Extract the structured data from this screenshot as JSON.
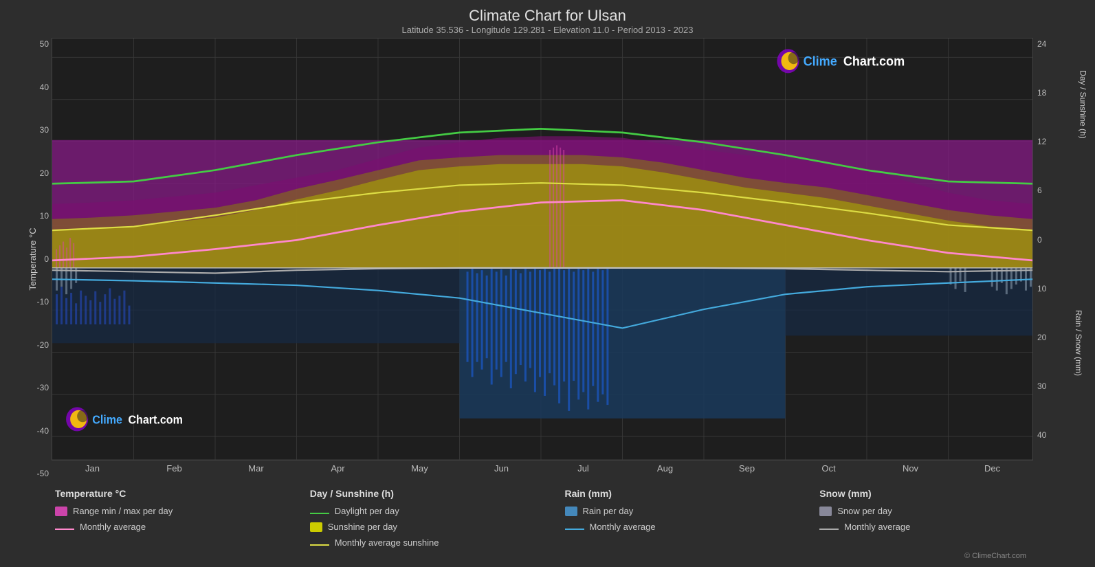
{
  "page": {
    "title": "Climate Chart for Ulsan",
    "subtitle": "Latitude 35.536 - Longitude 129.281 - Elevation 11.0 - Period 2013 - 2023"
  },
  "y_axis_left": {
    "label": "Temperature °C",
    "ticks": [
      "50",
      "40",
      "30",
      "20",
      "10",
      "0",
      "-10",
      "-20",
      "-30",
      "-40",
      "-50"
    ]
  },
  "y_axis_right_top": {
    "label": "Day / Sunshine (h)",
    "ticks": [
      "24",
      "18",
      "12",
      "6",
      "0"
    ]
  },
  "y_axis_right_bottom": {
    "label": "Rain / Snow (mm)",
    "ticks": [
      "0",
      "10",
      "20",
      "30",
      "40"
    ]
  },
  "x_axis": {
    "months": [
      "Jan",
      "Feb",
      "Mar",
      "Apr",
      "May",
      "Jun",
      "Jul",
      "Aug",
      "Sep",
      "Oct",
      "Nov",
      "Dec"
    ]
  },
  "legend": {
    "col1": {
      "title": "Temperature °C",
      "items": [
        {
          "type": "rect",
          "color": "#cc44aa",
          "label": "Range min / max per day"
        },
        {
          "type": "line",
          "color": "#ff88cc",
          "label": "Monthly average"
        }
      ]
    },
    "col2": {
      "title": "Day / Sunshine (h)",
      "items": [
        {
          "type": "line",
          "color": "#44cc44",
          "label": "Daylight per day"
        },
        {
          "type": "rect",
          "color": "#cccc00",
          "label": "Sunshine per day"
        },
        {
          "type": "line",
          "color": "#dddd44",
          "label": "Monthly average sunshine"
        }
      ]
    },
    "col3": {
      "title": "Rain (mm)",
      "items": [
        {
          "type": "rect",
          "color": "#4488bb",
          "label": "Rain per day"
        },
        {
          "type": "line",
          "color": "#44aadd",
          "label": "Monthly average"
        }
      ]
    },
    "col4": {
      "title": "Snow (mm)",
      "items": [
        {
          "type": "rect",
          "color": "#888899",
          "label": "Snow per day"
        },
        {
          "type": "line",
          "color": "#aaaaaa",
          "label": "Monthly average"
        }
      ]
    }
  },
  "watermark_top": "ClimeChart.com",
  "watermark_bottom": "ClimeChart.com",
  "copyright": "© ClimeChart.com"
}
